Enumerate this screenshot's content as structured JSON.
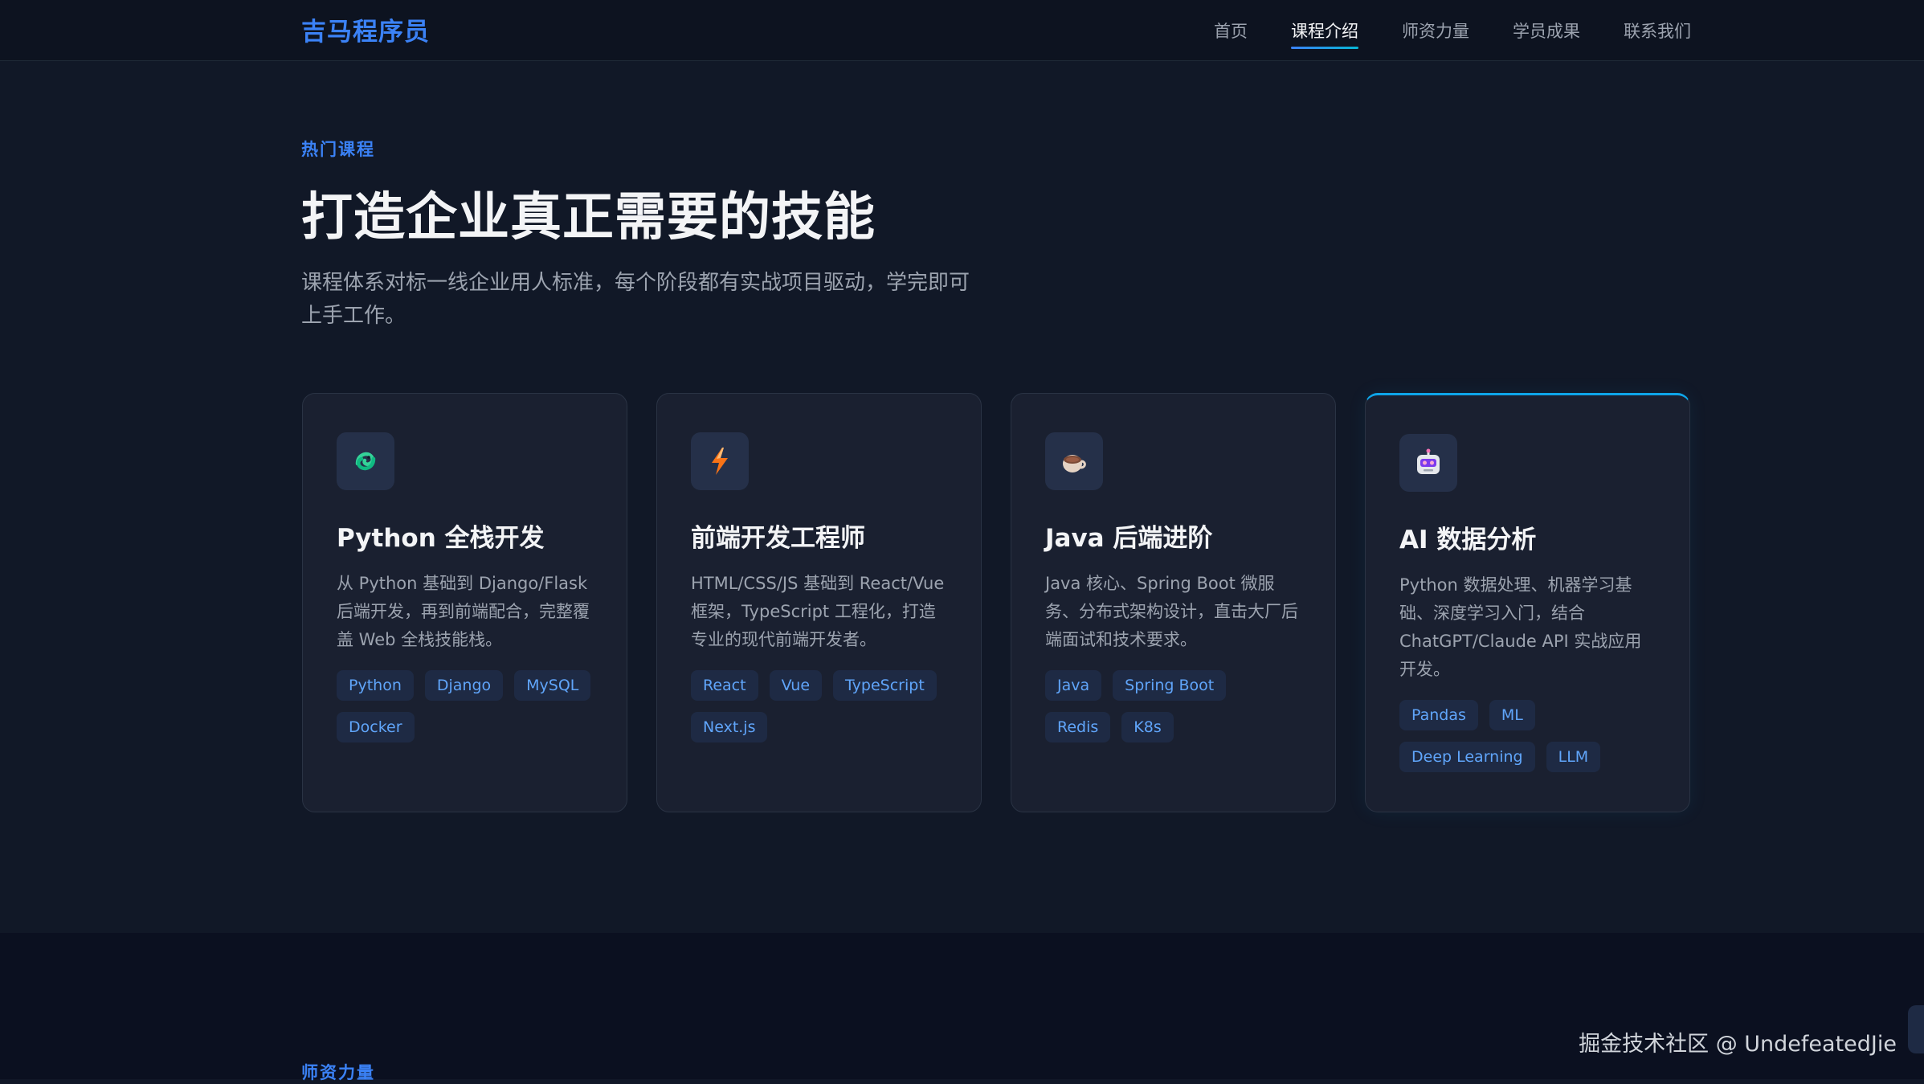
{
  "header": {
    "logo": "吉马程序员",
    "nav": [
      {
        "label": "首页",
        "active": false
      },
      {
        "label": "课程介绍",
        "active": true
      },
      {
        "label": "师资力量",
        "active": false
      },
      {
        "label": "学员成果",
        "active": false
      },
      {
        "label": "联系我们",
        "active": false
      }
    ]
  },
  "courses": {
    "tag": "热门课程",
    "title": "打造企业真正需要的技能",
    "desc": "课程体系对标一线企业用人标准，每个阶段都有实战项目驱动，学完即可上手工作。",
    "cards": [
      {
        "icon": "python-snake-icon",
        "title": "Python 全栈开发",
        "desc": "从 Python 基础到 Django/Flask 后端开发，再到前端配合，完整覆盖 Web 全栈技能栈。",
        "tags": [
          "Python",
          "Django",
          "MySQL",
          "Docker"
        ]
      },
      {
        "icon": "lightning-icon",
        "title": "前端开发工程师",
        "desc": "HTML/CSS/JS 基础到 React/Vue 框架，TypeScript 工程化，打造专业的现代前端开发者。",
        "tags": [
          "React",
          "Vue",
          "TypeScript",
          "Next.js"
        ]
      },
      {
        "icon": "coffee-cup-icon",
        "title": "Java 后端进阶",
        "desc": "Java 核心、Spring Boot 微服务、分布式架构设计，直击大厂后端面试和技术要求。",
        "tags": [
          "Java",
          "Spring Boot",
          "Redis",
          "K8s"
        ]
      },
      {
        "icon": "robot-icon",
        "title": "AI 数据分析",
        "desc": "Python 数据处理、机器学习基础、深度学习入门，结合 ChatGPT/Claude API 实战应用开发。",
        "tags": [
          "Pandas",
          "ML",
          "Deep Learning",
          "LLM"
        ]
      }
    ]
  },
  "teachers": {
    "tag": "师资力量"
  },
  "watermark": "掘金技术社区 @ UndefeatedJie",
  "colors": {
    "accent": "#3b82f6",
    "accent_cyan": "#0ea5e9",
    "background": "#111827"
  }
}
